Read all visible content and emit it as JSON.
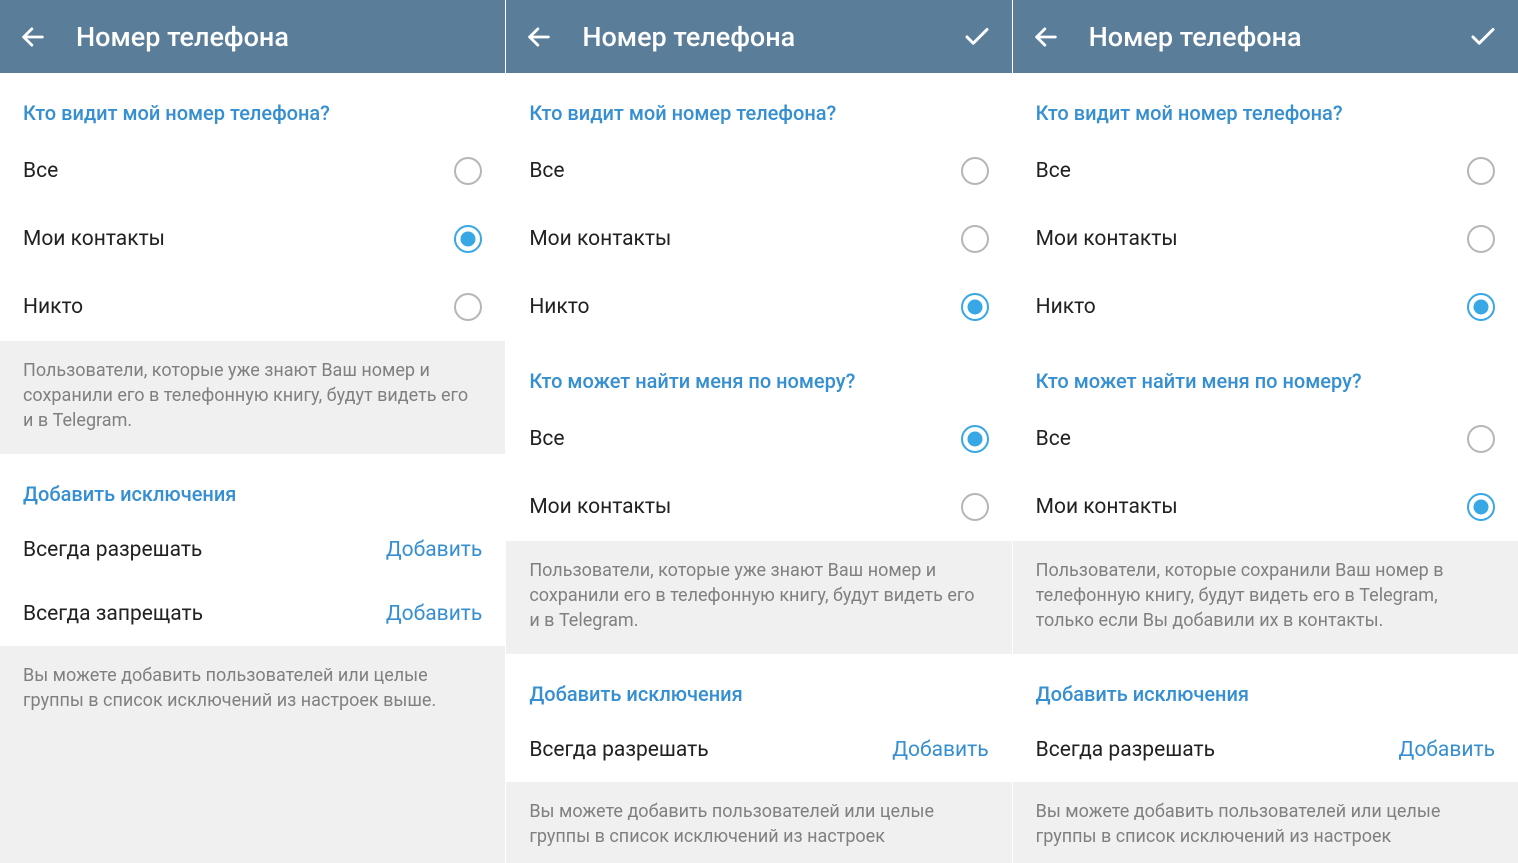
{
  "screens": [
    {
      "title": "Номер телефона",
      "hasCheck": false,
      "blocks": [
        {
          "type": "radio-section",
          "heading": "Кто видит мой номер телефона?",
          "options": [
            {
              "label": "Все",
              "selected": false
            },
            {
              "label": "Мои контакты",
              "selected": true
            },
            {
              "label": "Никто",
              "selected": false
            }
          ]
        },
        {
          "type": "footer",
          "text": "Пользователи, которые уже знают Ваш номер и сохранили его в телефонную книгу, будут видеть его и в Telegram."
        },
        {
          "type": "link-section",
          "heading": "Добавить исключения",
          "rows": [
            {
              "label": "Всегда разрешать",
              "action": "Добавить"
            },
            {
              "label": "Всегда запрещать",
              "action": "Добавить"
            }
          ]
        },
        {
          "type": "footer",
          "text": "Вы можете добавить пользователей или целые группы в список исключений из настроек выше."
        }
      ]
    },
    {
      "title": "Номер телефона",
      "hasCheck": true,
      "blocks": [
        {
          "type": "radio-section",
          "heading": "Кто видит мой номер телефона?",
          "options": [
            {
              "label": "Все",
              "selected": false
            },
            {
              "label": "Мои контакты",
              "selected": false
            },
            {
              "label": "Никто",
              "selected": true
            }
          ]
        },
        {
          "type": "radio-section",
          "heading": "Кто может найти меня по номеру?",
          "options": [
            {
              "label": "Все",
              "selected": true
            },
            {
              "label": "Мои контакты",
              "selected": false
            }
          ]
        },
        {
          "type": "footer",
          "text": "Пользователи, которые уже знают Ваш номер и сохранили его в телефонную книгу, будут видеть его и в Telegram."
        },
        {
          "type": "link-section",
          "heading": "Добавить исключения",
          "rows": [
            {
              "label": "Всегда разрешать",
              "action": "Добавить"
            }
          ]
        },
        {
          "type": "footer",
          "text": "Вы можете добавить пользователей или целые группы в список исключений из настроек"
        }
      ]
    },
    {
      "title": "Номер телефона",
      "hasCheck": true,
      "blocks": [
        {
          "type": "radio-section",
          "heading": "Кто видит мой номер телефона?",
          "options": [
            {
              "label": "Все",
              "selected": false
            },
            {
              "label": "Мои контакты",
              "selected": false
            },
            {
              "label": "Никто",
              "selected": true
            }
          ]
        },
        {
          "type": "radio-section",
          "heading": "Кто может найти меня по номеру?",
          "options": [
            {
              "label": "Все",
              "selected": false
            },
            {
              "label": "Мои контакты",
              "selected": true
            }
          ]
        },
        {
          "type": "footer",
          "text": "Пользователи, которые сохранили Ваш номер в телефонную книгу, будут видеть его в Telegram, только если Вы добавили их в контакты."
        },
        {
          "type": "link-section",
          "heading": "Добавить исключения",
          "rows": [
            {
              "label": "Всегда разрешать",
              "action": "Добавить"
            }
          ]
        },
        {
          "type": "footer",
          "text": "Вы можете добавить пользователей или целые группы в список исключений из настроек"
        }
      ]
    }
  ]
}
